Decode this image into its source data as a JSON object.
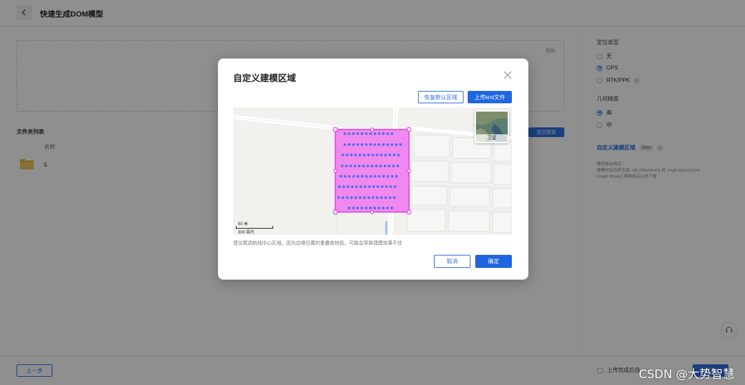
{
  "header": {
    "title": "快速生成DOM模型"
  },
  "main": {
    "help_label": "帮助",
    "folder_list_title": "文件夹列表",
    "column_name": "名称",
    "folders": [
      {
        "name": "S"
      }
    ],
    "locate_preview_label": "定位预览"
  },
  "right_panel": {
    "positioning_title": "定位类型",
    "positioning_options": [
      "无",
      "GPS",
      "RTK/PPK"
    ],
    "positioning_selected": "GPS",
    "precision_title": "几何精度",
    "precision_options": [
      "高",
      "中"
    ],
    "precision_selected": "高",
    "custom_area_label": "自定义建模区域",
    "beta_label": "Beta",
    "output_desc_line1": "模型输出格式：",
    "output_desc_line2": "建模完成后将生成 .obj (Wavefront) 和 .osgb (openScene",
    "output_desc_line3": "Graph Binary) 两种格式以供下载"
  },
  "footer": {
    "prev_label": "上一步",
    "upload_label": "上传完成后自",
    "submit_label": "提交"
  },
  "modal": {
    "title": "自定义建模区域",
    "restore_label": "恢复默认区域",
    "upload_kml_label": "上传kml文件",
    "satellite_label": "卫星",
    "scale_metric": "50 米",
    "scale_imperial": "300 英尺",
    "hint": "建议框选航线中心区域。因为边缘位置的重叠度较低，可能会导致建模效果不佳",
    "cancel_label": "取消",
    "confirm_label": "确定"
  },
  "watermark": "CSDN @大势智慧",
  "colors": {
    "primary": "#1f66e0",
    "selection_fill": "#f07cf0",
    "selection_stroke": "#e020e0",
    "flight_point": "#4a6fe8"
  },
  "icons": [
    "back-arrow-icon",
    "folder-icon",
    "close-icon",
    "info-icon",
    "headset-icon"
  ]
}
